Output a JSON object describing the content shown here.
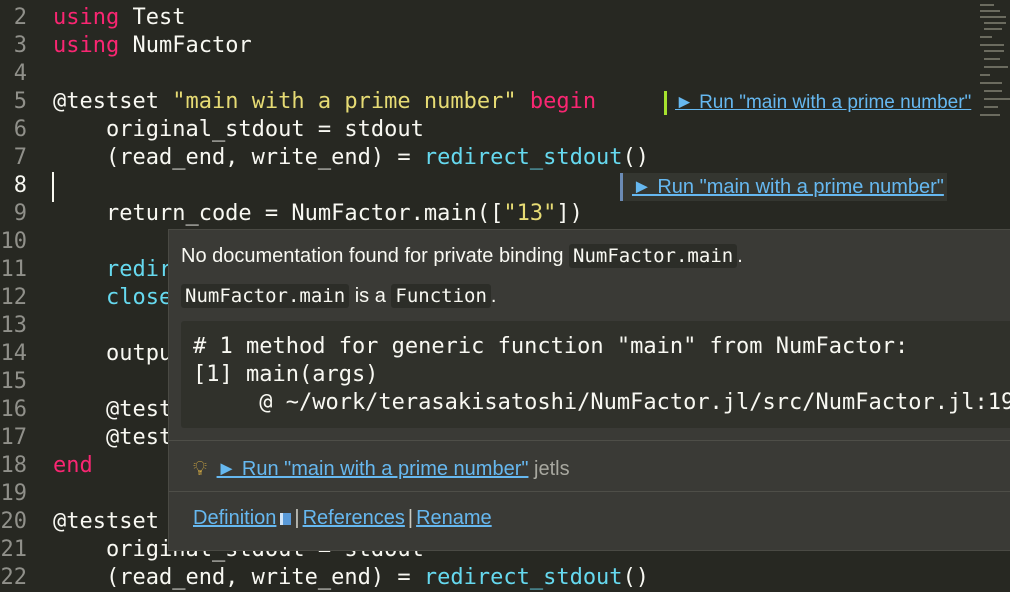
{
  "editor": {
    "lines": [
      {
        "no": "2",
        "parts": [
          {
            "t": "using",
            "c": "kw"
          },
          {
            "t": " Test",
            "c": ""
          }
        ]
      },
      {
        "no": "3",
        "parts": [
          {
            "t": "using",
            "c": "kw"
          },
          {
            "t": " NumFactor",
            "c": ""
          }
        ]
      },
      {
        "no": "4",
        "parts": []
      },
      {
        "no": "5",
        "parts": [
          {
            "t": "@testset ",
            "c": ""
          },
          {
            "t": "\"main with a prime number\"",
            "c": "str"
          },
          {
            "t": " begin",
            "c": "kw"
          }
        ]
      },
      {
        "no": "6",
        "parts": [
          {
            "t": "    original_stdout = stdout",
            "c": ""
          }
        ]
      },
      {
        "no": "7",
        "parts": [
          {
            "t": "    (read_end, write_end) = ",
            "c": ""
          },
          {
            "t": "redirect_stdout",
            "c": "fn"
          },
          {
            "t": "()",
            "c": ""
          }
        ]
      },
      {
        "no": "8",
        "parts": []
      },
      {
        "no": "9",
        "parts": [
          {
            "t": "    return_code = NumFactor.main([",
            "c": ""
          },
          {
            "t": "\"13\"",
            "c": "str"
          },
          {
            "t": "])",
            "c": ""
          }
        ]
      },
      {
        "no": "10",
        "parts": []
      },
      {
        "no": "11",
        "parts": [
          {
            "t": "    redir",
            "c": "fn"
          }
        ]
      },
      {
        "no": "12",
        "parts": [
          {
            "t": "    close",
            "c": "fn"
          }
        ]
      },
      {
        "no": "13",
        "parts": []
      },
      {
        "no": "14",
        "parts": [
          {
            "t": "    outpu",
            "c": ""
          }
        ]
      },
      {
        "no": "15",
        "parts": []
      },
      {
        "no": "16",
        "parts": [
          {
            "t": "    @test",
            "c": ""
          }
        ]
      },
      {
        "no": "17",
        "parts": [
          {
            "t": "    @test",
            "c": ""
          }
        ]
      },
      {
        "no": "18",
        "parts": [
          {
            "t": "end",
            "c": "kw"
          }
        ]
      },
      {
        "no": "19",
        "parts": []
      },
      {
        "no": "20",
        "parts": [
          {
            "t": "@testset",
            "c": ""
          }
        ]
      },
      {
        "no": "21",
        "parts": [
          {
            "t": "    original_stdout = stdout",
            "c": ""
          }
        ]
      },
      {
        "no": "22",
        "parts": [
          {
            "t": "    (read_end, write_end) = ",
            "c": ""
          },
          {
            "t": "redirect_stdout",
            "c": "fn"
          },
          {
            "t": "()",
            "c": ""
          }
        ]
      }
    ],
    "active_line": "8",
    "codelens_1": "► Run \"main with a prime number\"",
    "codelens_2": "► Run \"main with a prime number\""
  },
  "hover": {
    "doc_prefix": "No documentation found for private binding",
    "doc_binding": "NumFactor.main",
    "doc_suffix": ".",
    "type_name": "NumFactor.main",
    "type_mid": "is a",
    "type_value": "Function",
    "type_suffix": ".",
    "code_block": "# 1 method for generic function \"main\" from NumFactor:\n[1] main(args)\n     @ ~/work/terasakisatoshi/NumFactor.jl/src/NumFactor.jl:19",
    "action_label": "► Run \"main with a prime number\"",
    "action_source": "jetls",
    "links": {
      "definition": "Definition",
      "references": "References",
      "rename": "Rename",
      "separator": "|"
    }
  },
  "colors": {
    "background": "#272822",
    "keyword": "#f92672",
    "string": "#e6db74",
    "function": "#66d9ef",
    "link": "#66b8f0"
  }
}
